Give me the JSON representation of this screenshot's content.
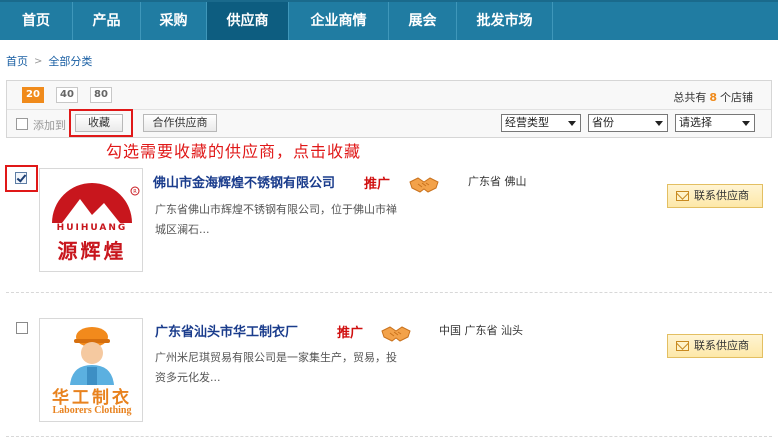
{
  "nav": {
    "items": [
      "首页",
      "产品",
      "采购",
      "供应商",
      "企业商情",
      "展会",
      "批发市场"
    ],
    "active_index": 3
  },
  "breadcrumb": {
    "home": "首页",
    "current": "全部分类"
  },
  "toolbar": {
    "page_sizes": [
      "20",
      "40",
      "80"
    ],
    "active_page_size": "20",
    "total_prefix": "总共有",
    "total_count": "8",
    "total_suffix": "个店铺",
    "add_to_label": "添加到",
    "favorite_button": "收藏",
    "partner_button": "合作供应商",
    "filters": {
      "business_type": "经营类型",
      "province": "省份",
      "choose": "请选择"
    }
  },
  "annotation": "勾选需要收藏的供应商，点击收藏",
  "suppliers": [
    {
      "name": "佛山市金海辉煌不锈钢有限公司",
      "promo": "推广",
      "location": "广东省  佛山",
      "desc_line1": "广东省佛山市辉煌不锈钢有限公司，位于佛山市禅",
      "desc_line2": "城区澜石...",
      "contact": "联系供应商",
      "checked": true,
      "logo": {
        "brand_en": "HUIHUANG",
        "brand_cn": "源辉煌",
        "color": "#c8161d"
      }
    },
    {
      "name": "广东省汕头市华工制衣厂",
      "promo": "推广",
      "location": "中国  广东省  汕头",
      "desc_line1": "广州米尼琪贸易有限公司是一家集生产，贸易，投",
      "desc_line2": "资多元化发...",
      "contact": "联系供应商",
      "checked": false,
      "logo": {
        "brand_cn": "华工制衣",
        "brand_en": "Laborers Clothing",
        "color": "#e8821e"
      }
    }
  ],
  "colors": {
    "nav": "#207ca2",
    "nav_active": "#0d5d80",
    "accent": "#f08b1c",
    "annotation": "#e01818",
    "link": "#1a3c8c"
  }
}
